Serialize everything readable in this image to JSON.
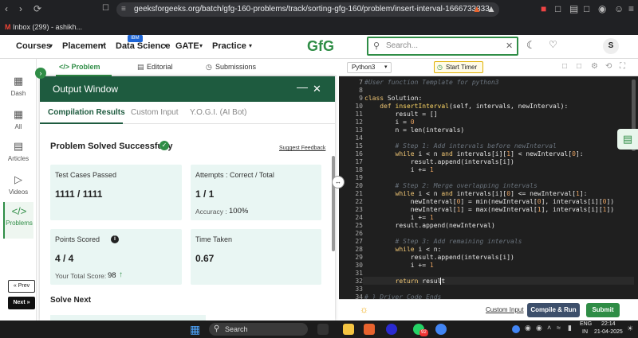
{
  "browser": {
    "url": "geeksforgeeks.org/batch/gfg-160-problems/track/sorting-gfg-160/problem/insert-interval-1666733333",
    "bookmark": "Inbox (299) - ashikh..."
  },
  "header": {
    "nav": [
      "Courses",
      "Placement",
      "Data Science",
      "GATE",
      "Practice"
    ],
    "ibm_badge": "IBM",
    "logo": "GfG",
    "search_placeholder": "Search...",
    "avatar": "S"
  },
  "sidebar": {
    "items": [
      {
        "label": "Dash",
        "icon": "dashboard-icon"
      },
      {
        "label": "All",
        "icon": "grid-icon"
      },
      {
        "label": "Articles",
        "icon": "book-icon"
      },
      {
        "label": "Videos",
        "icon": "video-icon"
      },
      {
        "label": "Problems",
        "icon": "code-icon"
      }
    ],
    "prev": "« Prev",
    "next": "Next »"
  },
  "problem_tabs": [
    "</> Problem",
    "Editorial",
    "Submissions"
  ],
  "output": {
    "title": "Output Window",
    "tabs": [
      "Compilation Results",
      "Custom Input",
      "Y.O.G.I. (AI Bot)"
    ],
    "status": "Problem Solved Successfully",
    "feedback": "Suggest Feedback",
    "cards": {
      "tests_label": "Test Cases Passed",
      "tests_value": "1111 / 1111",
      "attempts_label": "Attempts : Correct / Total",
      "attempts_value": "1 / 1",
      "accuracy_label": "Accuracy :",
      "accuracy_value": "100%",
      "points_label": "Points Scored",
      "points_value": "4 / 4",
      "total_label": "Your Total Score:",
      "total_value": "98",
      "time_label": "Time Taken",
      "time_value": "0.67"
    },
    "solve_next": "Solve Next"
  },
  "editor": {
    "language": "Python3",
    "timer": "Start Timer",
    "lines": [
      {
        "n": "7",
        "html": "<span class=\"cm\">#User function Template for python3</span>"
      },
      {
        "n": "8",
        "html": ""
      },
      {
        "n": "9",
        "html": "<span class=\"kw\">class</span> Solution:"
      },
      {
        "n": "10",
        "html": "    <span class=\"kw\">def</span> <span class=\"fn\">insertInterval</span>(self, intervals, newInterval):"
      },
      {
        "n": "11",
        "html": "        result = []"
      },
      {
        "n": "12",
        "html": "        i = <span class=\"num\">0</span>"
      },
      {
        "n": "13",
        "html": "        n = len(intervals)"
      },
      {
        "n": "14",
        "html": ""
      },
      {
        "n": "15",
        "html": "        <span class=\"cm\"># Step 1: Add intervals before newInterval</span>"
      },
      {
        "n": "16",
        "html": "        <span class=\"kw\">while</span> i &lt; n <span class=\"kw\">and</span> intervals[i][<span class=\"num\">1</span>] &lt; newInterval[<span class=\"num\">0</span>]:"
      },
      {
        "n": "17",
        "html": "            result.append(intervals[i])"
      },
      {
        "n": "18",
        "html": "            i += <span class=\"num\">1</span>"
      },
      {
        "n": "19",
        "html": ""
      },
      {
        "n": "20",
        "html": "        <span class=\"cm\"># Step 2: Merge overlapping intervals</span>"
      },
      {
        "n": "21",
        "html": "        <span class=\"kw\">while</span> i &lt; n <span class=\"kw\">and</span> intervals[i][<span class=\"num\">0</span>] &lt;= newInterval[<span class=\"num\">1</span>]:"
      },
      {
        "n": "22",
        "html": "            newInterval[<span class=\"num\">0</span>] = min(newInterval[<span class=\"num\">0</span>], intervals[i][<span class=\"num\">0</span>])"
      },
      {
        "n": "23",
        "html": "            newInterval[<span class=\"num\">1</span>] = max(newInterval[<span class=\"num\">1</span>], intervals[i][<span class=\"num\">1</span>])"
      },
      {
        "n": "24",
        "html": "            i += <span class=\"num\">1</span>"
      },
      {
        "n": "25",
        "html": "        result.append(newInterval)"
      },
      {
        "n": "26",
        "html": ""
      },
      {
        "n": "27",
        "html": "        <span class=\"cm\"># Step 3: Add remaining intervals</span>"
      },
      {
        "n": "28",
        "html": "        <span class=\"kw\">while</span> i &lt; n:"
      },
      {
        "n": "29",
        "html": "            result.append(intervals[i])"
      },
      {
        "n": "30",
        "html": "            i += <span class=\"num\">1</span>"
      },
      {
        "n": "31",
        "html": ""
      },
      {
        "n": "32",
        "html": "        <span class=\"kw\">return</span> result"
      },
      {
        "n": "33",
        "html": ""
      },
      {
        "n": "34",
        "html": "<span class=\"cm\"># } Driver Code Ends</span>"
      }
    ],
    "custom_input": "Custom Input",
    "compile": "Compile & Run",
    "submit": "Submit"
  },
  "taskbar": {
    "search": "Search",
    "lang": "ENG",
    "region": "IN",
    "time": "22:14",
    "date": "21-04-2025",
    "whatsapp_badge": "92"
  },
  "colors": {
    "brand": "#2f8d46",
    "output_header": "#1e5b3f",
    "card_bg": "#e9f6f3",
    "editor_bg": "#1f1f1f"
  }
}
